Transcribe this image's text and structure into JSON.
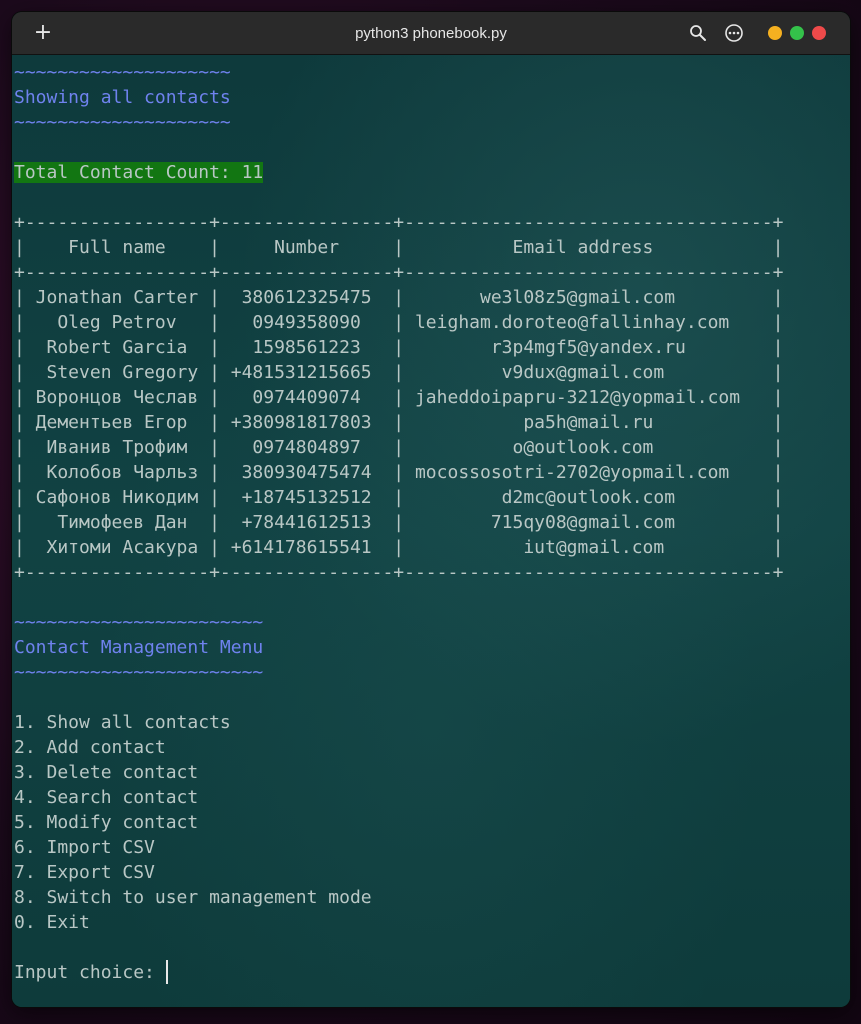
{
  "window": {
    "title": "python3 phonebook.py",
    "colors": {
      "close": "#ee4a4a",
      "minimize": "#f5b020",
      "maximize": "#34c24a"
    },
    "icons": [
      "new-tab-icon",
      "search-icon",
      "menu-icon"
    ]
  },
  "terminal": {
    "colors": {
      "background": "#0f3b3c",
      "text": "#b9c7c5",
      "heading": "#6f82ee",
      "highlight": "#127612"
    },
    "section1": {
      "wave": "~~~~~~~~~~~~~~~~~~~~",
      "title": "Showing all contacts",
      "count_label": "Total Contact Count: 11"
    },
    "table": {
      "border": "+-----------------+----------------+----------------------------------+",
      "header_row": "|    Full name    |     Number     |          Email address           |",
      "rows": [
        "| Jonathan Carter |  380612325475  |       we3l08z5@gmail.com         |",
        "|   Oleg Petrov   |   0949358090   | leigham.doroteo@fallinhay.com    |",
        "|  Robert Garcia  |   1598561223   |        r3p4mgf5@yandex.ru        |",
        "|  Steven Gregory | +481531215665  |         v9dux@gmail.com          |",
        "| Воронцов Чеслав |   0974409074   | jaheddoipapru-3212@yopmail.com   |",
        "| Дементьев Егор  | +380981817803  |           pa5h@mail.ru           |",
        "|  Иванив Трофим  |   0974804897   |          o@outlook.com           |",
        "|  Колобов Чарльз |  380930475474  | mocossosotri-2702@yopmail.com    |",
        "| Сафонов Никодим |  +18745132512  |         d2mc@outlook.com         |",
        "|   Тимофеев Дан  |  +78441612513  |        715qy08@gmail.com         |",
        "|  Хитоми Асакура | +614178615541  |           iut@gmail.com          |"
      ]
    },
    "menu": {
      "wave": "~~~~~~~~~~~~~~~~~~~~~~~",
      "title": "Contact Management Menu",
      "items": [
        "1. Show all contacts",
        "2. Add contact",
        "3. Delete contact",
        "4. Search contact",
        "5. Modify contact",
        "6. Import CSV",
        "7. Export CSV",
        "8. Switch to user management mode",
        "0. Exit"
      ]
    },
    "prompt": "Input choice: "
  }
}
